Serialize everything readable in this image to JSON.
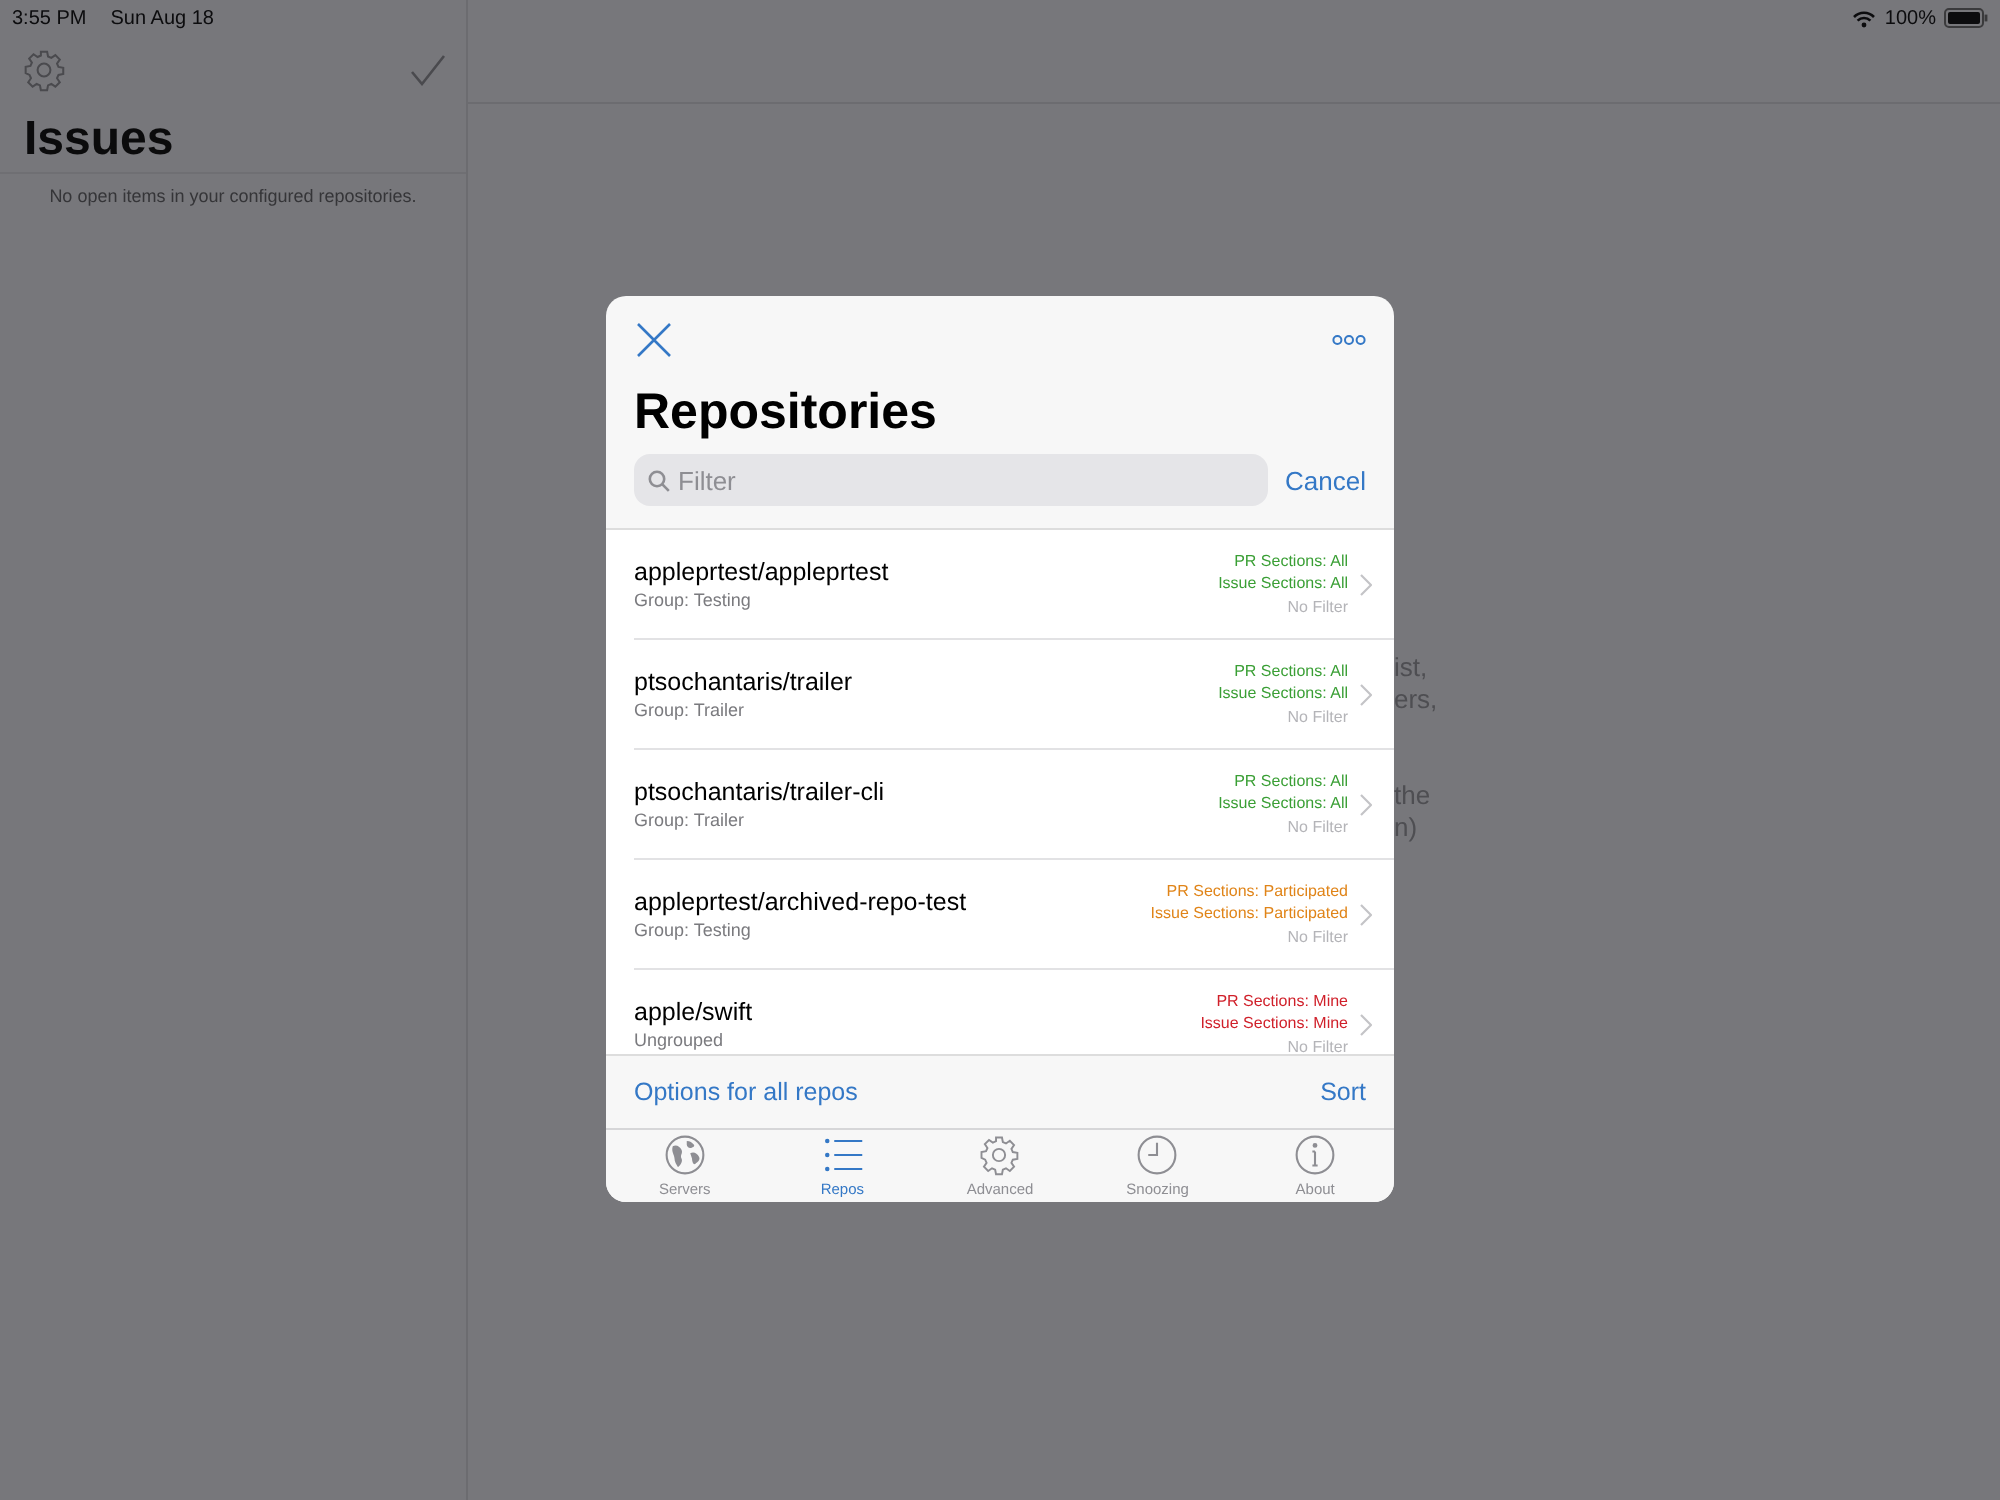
{
  "status_bar": {
    "time": "3:55 PM",
    "date": "Sun Aug 18",
    "battery": "100%"
  },
  "sidebar": {
    "title": "Issues",
    "empty_message": "No open items in your configured repositories."
  },
  "detail": {
    "visible_text_fragments": [
      "ist,",
      "ers,",
      "the",
      "n)"
    ]
  },
  "dialog": {
    "title": "Repositories",
    "search": {
      "placeholder": "Filter"
    },
    "cancel": "Cancel",
    "repositories": [
      {
        "name": "appleprtest/appleprtest",
        "group": "Group: Testing",
        "pr_sections": "PR Sections: All",
        "issue_sections": "Issue Sections: All",
        "filter": "No Filter",
        "color": "#3a9f35"
      },
      {
        "name": "ptsochantaris/trailer",
        "group": "Group: Trailer",
        "pr_sections": "PR Sections: All",
        "issue_sections": "Issue Sections: All",
        "filter": "No Filter",
        "color": "#3a9f35"
      },
      {
        "name": "ptsochantaris/trailer-cli",
        "group": "Group: Trailer",
        "pr_sections": "PR Sections: All",
        "issue_sections": "Issue Sections: All",
        "filter": "No Filter",
        "color": "#3a9f35"
      },
      {
        "name": "appleprtest/archived-repo-test",
        "group": "Group: Testing",
        "pr_sections": "PR Sections: Participated",
        "issue_sections": "Issue Sections: Participated",
        "filter": "No Filter",
        "color": "#e08418"
      },
      {
        "name": "apple/swift",
        "group": "Ungrouped",
        "pr_sections": "PR Sections: Mine",
        "issue_sections": "Issue Sections: Mine",
        "filter": "No Filter",
        "color": "#d0202a"
      }
    ],
    "footer": {
      "options": "Options for all repos",
      "sort": "Sort"
    },
    "tabs": [
      {
        "kind": "globe",
        "label": "Servers",
        "selected": false
      },
      {
        "kind": "list",
        "label": "Repos",
        "selected": true
      },
      {
        "kind": "gear",
        "label": "Advanced",
        "selected": false
      },
      {
        "kind": "clock",
        "label": "Snoozing",
        "selected": false
      },
      {
        "kind": "info",
        "label": "About",
        "selected": false
      }
    ]
  }
}
